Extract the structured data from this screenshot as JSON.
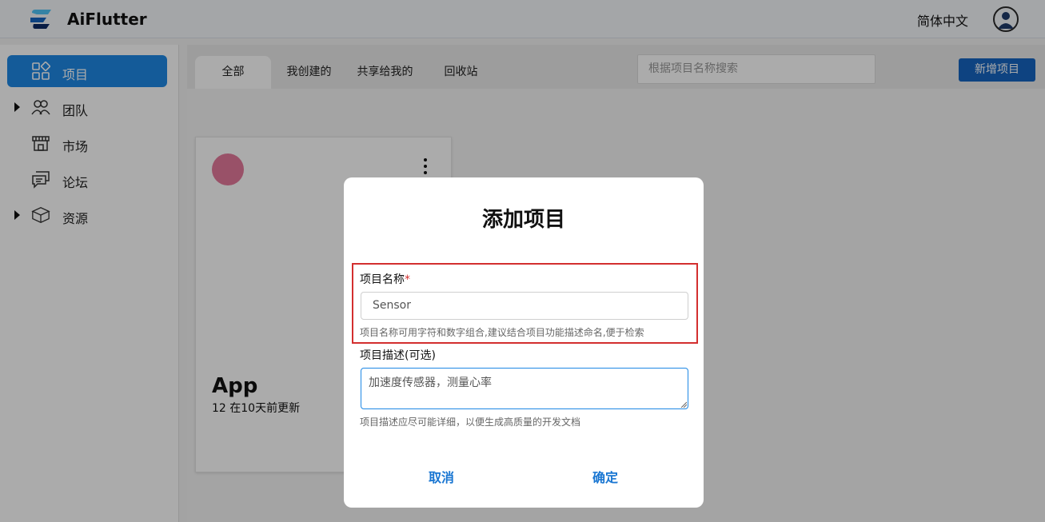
{
  "app": {
    "title": "AiFlutter"
  },
  "header": {
    "language": "简体中文"
  },
  "sidebar": {
    "items": [
      {
        "label": "项目",
        "icon": "grid-icon",
        "active": true
      },
      {
        "label": "团队",
        "icon": "people-icon",
        "expandable": true
      },
      {
        "label": "市场",
        "icon": "store-icon"
      },
      {
        "label": "论坛",
        "icon": "chat-icon"
      },
      {
        "label": "资源",
        "icon": "box-icon",
        "expandable": true
      }
    ]
  },
  "tabs": [
    {
      "label": "全部",
      "active": true
    },
    {
      "label": "我创建的"
    },
    {
      "label": "共享给我的"
    },
    {
      "label": "回收站"
    }
  ],
  "search": {
    "placeholder": "根据项目名称搜索"
  },
  "toolbar": {
    "add_label": "新增项目"
  },
  "card": {
    "name": "App",
    "meta": "12 在10天前更新",
    "accent": "#e57a9b"
  },
  "dialog": {
    "title": "添加项目",
    "name_label": "项目名称",
    "required_mark": "*",
    "name_value": "Sensor",
    "name_hint": "项目名称可用字符和数字组合,建议结合项目功能描述命名,便于检索",
    "desc_label": "项目描述(可选)",
    "desc_value": "加速度传感器，测量心率",
    "desc_hint": "项目描述应尽可能详细，以便生成高质量的开发文档",
    "cancel_label": "取消",
    "confirm_label": "确定"
  },
  "colors": {
    "primary": "#1e88e5",
    "button": "#1565c0",
    "error": "#d32f2f"
  }
}
